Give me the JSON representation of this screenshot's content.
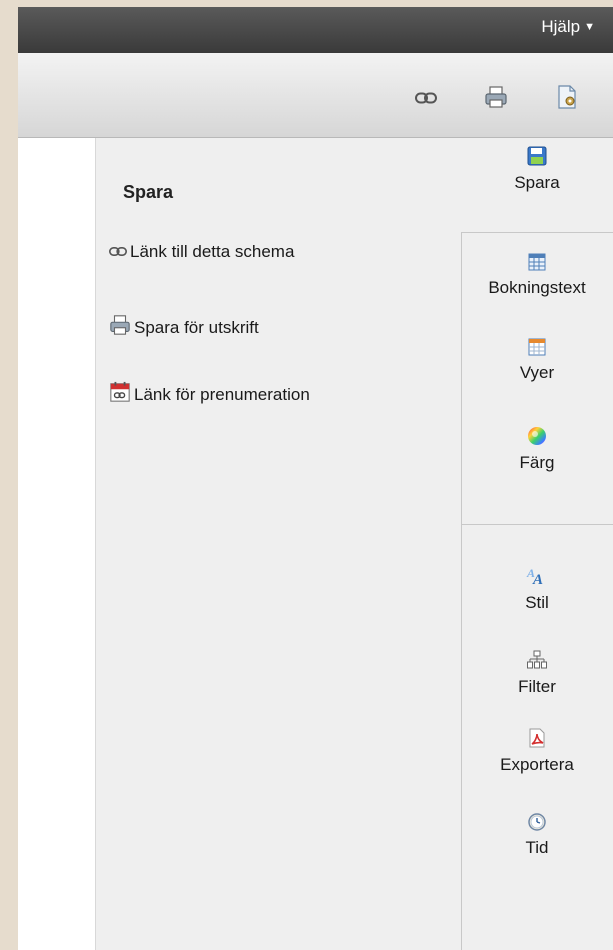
{
  "topbar": {
    "help_label": "Hjälp",
    "help_caret": "▼"
  },
  "toolbar": {
    "icons": [
      "link-icon",
      "printer-icon",
      "settings-document-icon"
    ]
  },
  "panel": {
    "title": "Spara",
    "options": [
      {
        "label": "Länk till detta schema",
        "icon": "link-icon"
      },
      {
        "label": "Spara för utskrift",
        "icon": "printer-icon"
      },
      {
        "label": "Länk för prenumeration",
        "icon": "calendar-link-icon"
      }
    ]
  },
  "sidebar": {
    "items": [
      {
        "label": "Spara",
        "icon": "floppy-disk-icon"
      },
      {
        "label": "Bokningstext",
        "icon": "table-icon"
      },
      {
        "label": "Vyer",
        "icon": "calendar-grid-icon"
      },
      {
        "label": "Färg",
        "icon": "color-wheel-icon"
      },
      {
        "label": "Stil",
        "icon": "font-style-icon"
      },
      {
        "label": "Filter",
        "icon": "filter-tree-icon"
      },
      {
        "label": "Exportera",
        "icon": "pdf-icon"
      },
      {
        "label": "Tid",
        "icon": "clock-icon"
      }
    ]
  },
  "colors": {
    "topbar": "#454545",
    "panel_bg": "#efefef",
    "accent_blue": "#3a78c9",
    "pdf_red": "#d32f2f"
  }
}
